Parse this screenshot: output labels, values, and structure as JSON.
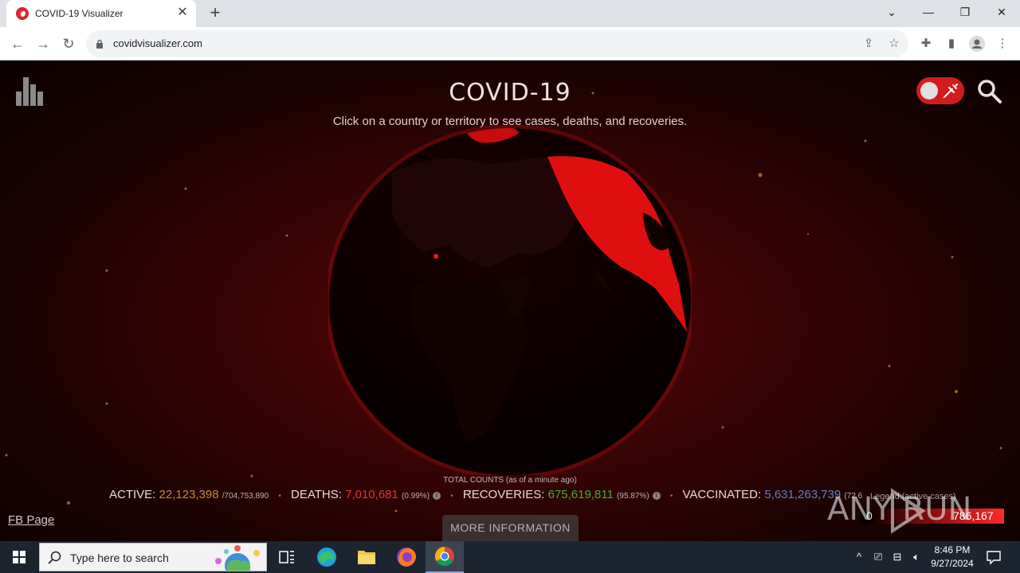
{
  "browser": {
    "tab_title": "COVID-19 Visualizer",
    "url": "covidvisualizer.com"
  },
  "page": {
    "title": "COVID-19",
    "subtitle": "Click on a country or territory to see cases, deaths, and recoveries.",
    "totals_caption": "TOTAL COUNTS (as of a minute ago)",
    "stats": {
      "active_label": "ACTIVE:",
      "active_value": "22,123,398",
      "active_total": "/704,753,890",
      "deaths_label": "DEATHS:",
      "deaths_value": "7,010,681",
      "deaths_pct": "(0.99%)",
      "recoveries_label": "RECOVERIES:",
      "recoveries_value": "675,619,811",
      "recoveries_pct": "(95.87%)",
      "vaccinated_label": "VACCINATED:",
      "vaccinated_value": "5,631,263,739",
      "vaccinated_pct": "(72.6"
    },
    "legend": {
      "label": "Legend (active cases)",
      "min": "0",
      "max": "786,167"
    },
    "fb_link": "FB Page",
    "more_button": "MORE INFORMATION",
    "watermark": "ANY RUN",
    "colors": {
      "active": "#c58a3a",
      "deaths": "#e0332f",
      "recoveries": "#3fae3c",
      "vaccinated": "#5a7fc4",
      "accent": "#d31d1d"
    }
  },
  "taskbar": {
    "search_placeholder": "Type here to search",
    "time": "8:46 PM",
    "date": "9/27/2024"
  }
}
